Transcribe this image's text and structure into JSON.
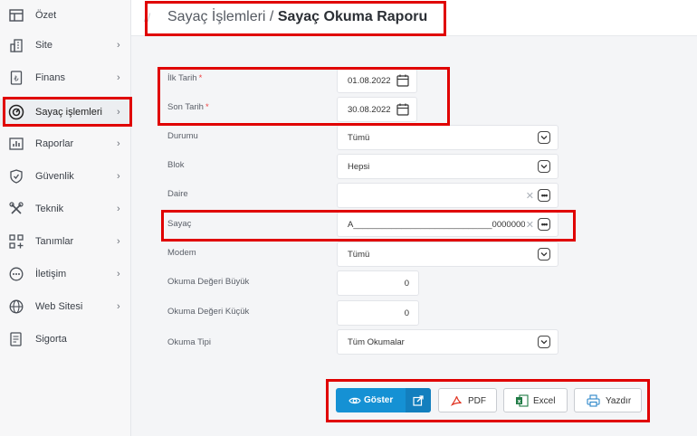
{
  "sidebar": {
    "items": [
      {
        "label": "Özet",
        "icon": "table-icon",
        "chevron": false
      },
      {
        "label": "Site",
        "icon": "building-icon",
        "chevron": true
      },
      {
        "label": "Finans",
        "icon": "lira-receipt-icon",
        "chevron": true
      },
      {
        "label": "Sayaç işlemleri",
        "icon": "gauge-icon",
        "chevron": true,
        "active": true
      },
      {
        "label": "Raporlar",
        "icon": "bar-chart-icon",
        "chevron": true
      },
      {
        "label": "Güvenlik",
        "icon": "shield-icon",
        "chevron": true
      },
      {
        "label": "Teknik",
        "icon": "tools-icon",
        "chevron": true
      },
      {
        "label": "Tanımlar",
        "icon": "grid-plus-icon",
        "chevron": true
      },
      {
        "label": "İletişim",
        "icon": "chat-dots-icon",
        "chevron": true
      },
      {
        "label": "Web Sitesi",
        "icon": "globe-icon",
        "chevron": true
      },
      {
        "label": "Sigorta",
        "icon": "document-icon",
        "chevron": false
      }
    ],
    "chevron_glyph": "›"
  },
  "header": {
    "separator": "//",
    "crumb_parent": "Sayaç İşlemleri / ",
    "crumb_current": "Sayaç Okuma Raporu"
  },
  "form": {
    "ilk_tarih": {
      "label": "İlk Tarih",
      "required": "*",
      "value": "01.08.2022"
    },
    "son_tarih": {
      "label": "Son Tarih",
      "required": "*",
      "value": "30.08.2022"
    },
    "durumu": {
      "label": "Durumu",
      "value": "Tümü"
    },
    "blok": {
      "label": "Blok",
      "value": "Hepsi"
    },
    "daire": {
      "label": "Daire",
      "value": ""
    },
    "sayac": {
      "label": "Sayaç",
      "value": "A_____________________________000000000000..."
    },
    "modem": {
      "label": "Modem",
      "value": "Tümü"
    },
    "okuma_buyuk": {
      "label": "Okuma Değeri Büyük",
      "value": "0"
    },
    "okuma_kucuk": {
      "label": "Okuma Değeri Küçük",
      "value": "0"
    },
    "okuma_tipi": {
      "label": "Okuma Tipi",
      "value": "Tüm Okumalar"
    },
    "clear_glyph": "✕",
    "dots_glyph": "•••"
  },
  "actions": {
    "goster": "Göster",
    "pdf": "PDF",
    "excel": "Excel",
    "yazdir": "Yazdır"
  },
  "colors": {
    "accent": "#1591d4",
    "annotation": "#e00000",
    "pdf_red": "#e0301e",
    "excel_green": "#1f7a44",
    "print_blue": "#2a85c8"
  }
}
